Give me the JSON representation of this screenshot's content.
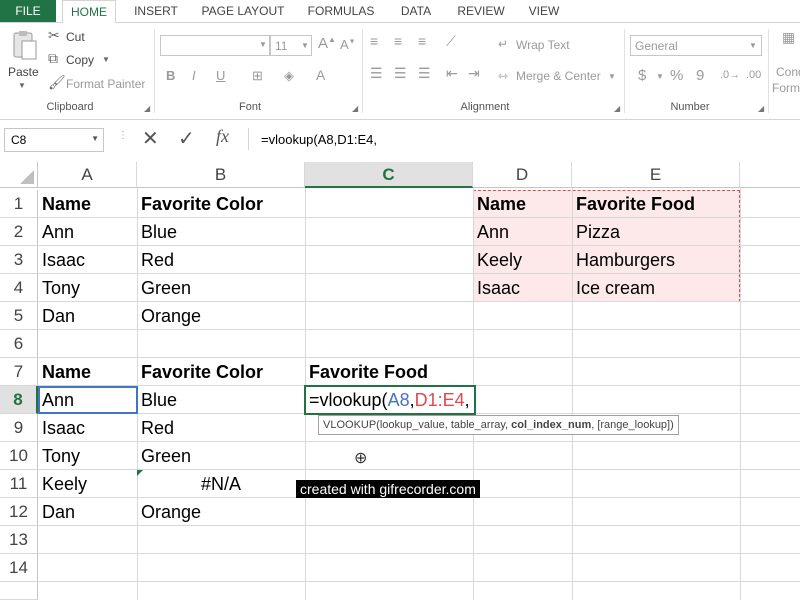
{
  "tabs": [
    "FILE",
    "HOME",
    "INSERT",
    "PAGE LAYOUT",
    "FORMULAS",
    "DATA",
    "REVIEW",
    "VIEW"
  ],
  "ribbon": {
    "clipboard": {
      "paste": "Paste",
      "cut": "Cut",
      "copy": "Copy",
      "format_painter": "Format Painter",
      "label": "Clipboard"
    },
    "font": {
      "size": "11",
      "label": "Font",
      "bold": "B",
      "italic": "I",
      "underline": "U"
    },
    "alignment": {
      "wrap_text": "Wrap Text",
      "merge_center": "Merge & Center",
      "label": "Alignment"
    },
    "number": {
      "format": "General",
      "currency": "$",
      "percent": "%",
      "comma": "9",
      "label": "Number"
    },
    "styles": {
      "cond_line1": "Cond",
      "cond_line2": "Form"
    }
  },
  "formula_bar": {
    "name_box": "C8",
    "fx": "fx",
    "formula": "=vlookup(A8,D1:E4,"
  },
  "columns": [
    "A",
    "B",
    "C",
    "D",
    "E"
  ],
  "rows": [
    "1",
    "2",
    "3",
    "4",
    "5",
    "6",
    "7",
    "8",
    "9",
    "10",
    "11",
    "12",
    "13",
    "14"
  ],
  "cells": {
    "A1": "Name",
    "B1": "Favorite Color",
    "D1": "Name",
    "E1": "Favorite Food",
    "A2": "Ann",
    "B2": "Blue",
    "D2": "Ann",
    "E2": "Pizza",
    "A3": "Isaac",
    "B3": "Red",
    "D3": "Keely",
    "E3": "Hamburgers",
    "A4": "Tony",
    "B4": "Green",
    "D4": "Isaac",
    "E4": "Ice cream",
    "A5": "Dan",
    "B5": "Orange",
    "A7": "Name",
    "B7": "Favorite Color",
    "C7": "Favorite Food",
    "A8": "Ann",
    "B8": "Blue",
    "A9": "Isaac",
    "B9": "Red",
    "A10": "Tony",
    "B10": "Green",
    "A11": "Keely",
    "B11": "#N/A",
    "A12": "Dan",
    "B12": "Orange"
  },
  "edit_cell": {
    "prefix": "=vlookup(",
    "arg1": "A8",
    "comma1": ",",
    "arg2": "D1:E4",
    "comma2": ","
  },
  "tooltip": {
    "fn": "VLOOKUP(",
    "a1": "lookup_value, ",
    "a2": "table_array, ",
    "a3": "col_index_num",
    "a4": ", [range_lookup])"
  },
  "watermark": "created with gifrecorder.com",
  "colors": {
    "excel_green": "#217346",
    "ref_blue": "#4472c4",
    "ref_red": "#e0494d",
    "range_fill": "#fde9e9"
  }
}
